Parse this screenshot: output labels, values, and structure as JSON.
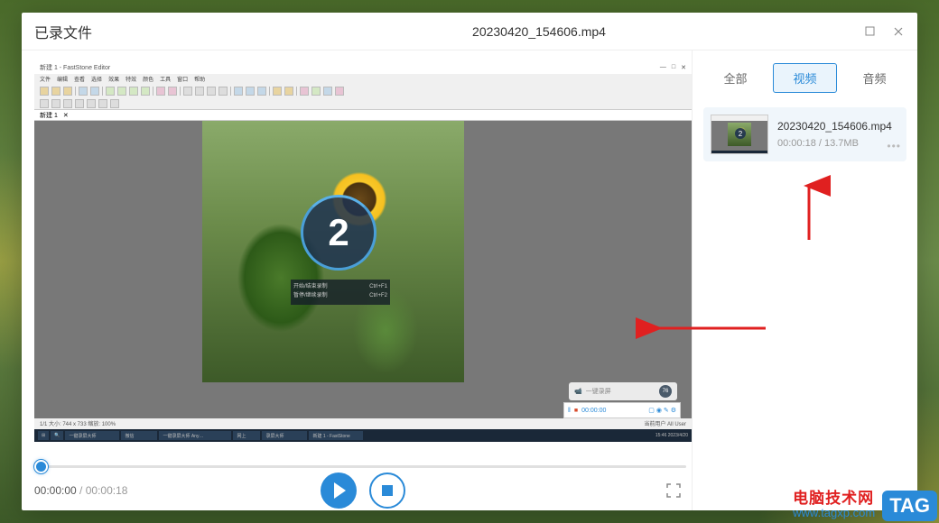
{
  "window": {
    "title_left": "已录文件",
    "title_center": "20230420_154606.mp4"
  },
  "preview": {
    "editor_title": "新建 1 - FastStone Editor",
    "countdown": "2",
    "shortcut1_label": "开始/结束录制",
    "shortcut1_key": "Ctrl+F1",
    "shortcut2_label": "暂停/继续录制",
    "shortcut2_key": "Ctrl+F2",
    "status_left": "1/1   大小: 744 x 733   缩放: 100%",
    "status_right": "当前用户   All User",
    "time_taskbar": "15:46\n2023/4/20",
    "rec_timer": "00:00:00",
    "watermark_text": "一键录屏"
  },
  "playback": {
    "current": "00:00:00",
    "total": "00:00:18"
  },
  "sidebar": {
    "tabs": [
      "全部",
      "视频",
      "音频"
    ],
    "active_index": 1,
    "files": [
      {
        "name": "20230420_154606.mp4",
        "duration": "00:00:18",
        "size": "13.7MB",
        "thumb_count": "2"
      }
    ]
  },
  "watermark": {
    "cn": "电脑技术网",
    "url": "www.tagxp.com",
    "tag": "TAG"
  }
}
